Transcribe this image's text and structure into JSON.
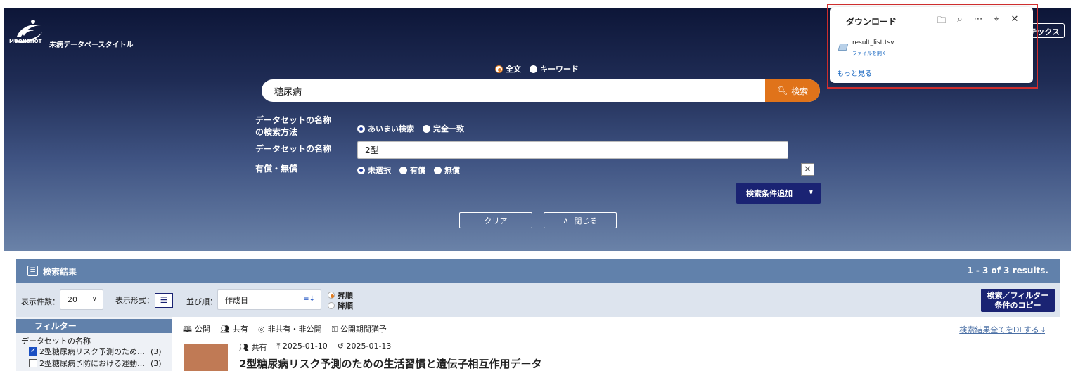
{
  "header": {
    "logo_text": "MOONSHOT",
    "site_title": "未病データベースタイトル",
    "index_button": "テックス"
  },
  "search": {
    "mode_fulltext": "全文",
    "mode_keyword": "キーワード",
    "query": "糖尿病",
    "button_label": "検索"
  },
  "conditions": {
    "name_method_label_1": "データセットの名称",
    "name_method_label_2": "の検索方法",
    "fuzzy": "あいまい検索",
    "exact": "完全一致",
    "name_label": "データセットの名称",
    "name_value": "2型",
    "paid_label": "有償・無償",
    "unselected": "未選択",
    "paid": "有償",
    "free": "無償",
    "add_condition": "検索条件追加",
    "clear": "クリア",
    "close": "閉じる"
  },
  "downloads": {
    "title": "ダウンロード",
    "file_name": "result_list.tsv",
    "open_file": "ファイルを開く",
    "see_more": "もっと見る",
    "icons": [
      "folder-icon",
      "search-icon",
      "more-icon",
      "pin-icon",
      "close-icon"
    ]
  },
  "results": {
    "title": "検索結果",
    "count": "1 - 3 of 3 results.",
    "per_page_label": "表示件数：",
    "per_page_value": "20",
    "format_label": "表示形式：",
    "sort_label": "並び順：",
    "sort_value": "作成日",
    "asc": "昇順",
    "desc": "降順",
    "copy_button_1": "検索／フィルター",
    "copy_button_2": "条件のコピー"
  },
  "filter": {
    "title": "フィルター",
    "section": "データセットの名称",
    "items": [
      {
        "label": "2型糖尿病リスク予測のため…",
        "count": "(3)",
        "checked": true
      },
      {
        "label": "2型糖尿病予防における運動…",
        "count": "(3)",
        "checked": false
      }
    ]
  },
  "content": {
    "legend": [
      "公開",
      "共有",
      "非共有・非公開",
      "公開期間猶予"
    ],
    "download_all": "検索結果全てをDLする",
    "item": {
      "share": "共有",
      "uploaded": "2025-01-10",
      "updated": "2025-01-13",
      "title": "2型糖尿病リスク予測のための生活習慣と遺伝子相互作用データ"
    }
  },
  "colors": {
    "accent_orange": "#e0731a",
    "navy": "#1a2373",
    "bar_blue": "#6181ab"
  }
}
